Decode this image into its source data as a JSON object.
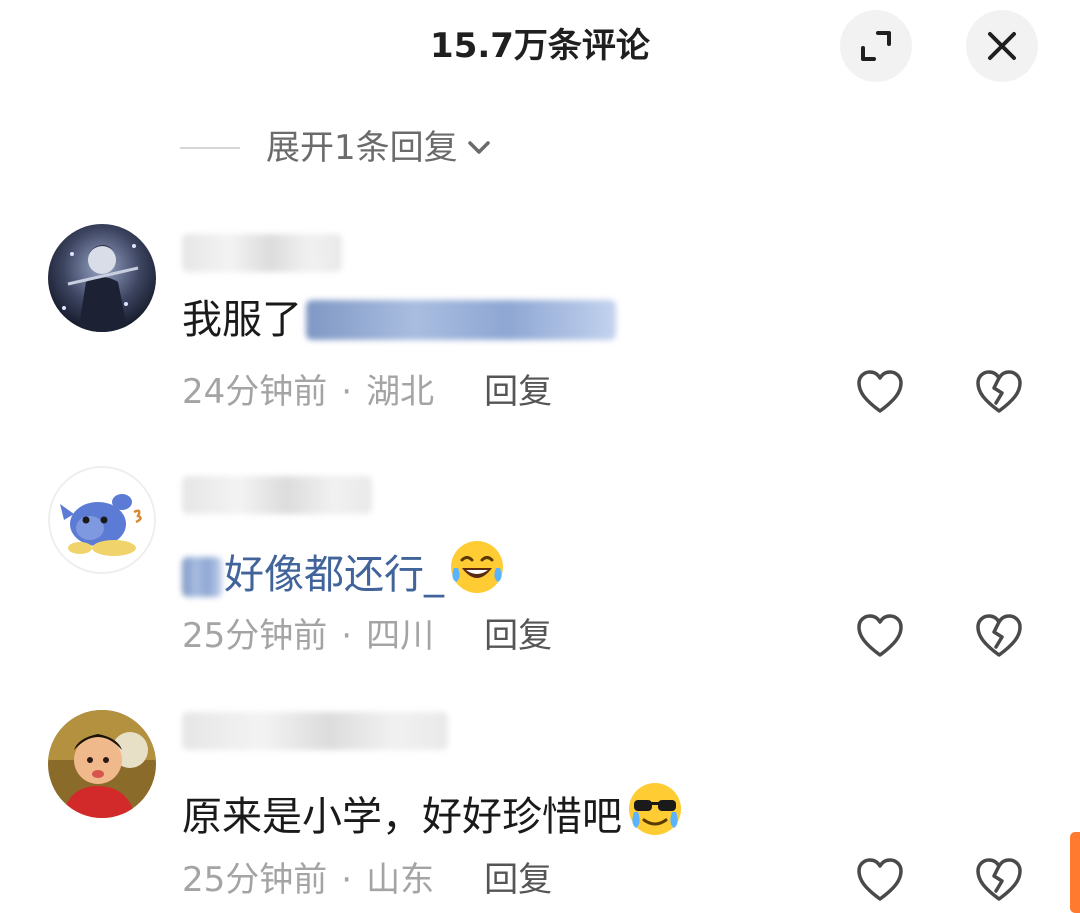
{
  "header": {
    "title": "15.7万条评论"
  },
  "expand_replies": {
    "label": "展开1条回复"
  },
  "comments": [
    {
      "content_prefix": "我服了",
      "mention": "",
      "content_suffix": "",
      "time": "24分钟前",
      "location": "湖北",
      "reply_label": "回复"
    },
    {
      "content_prefix": "",
      "mention": "好像都还行_",
      "content_suffix": "",
      "time": "25分钟前",
      "location": "四川",
      "reply_label": "回复"
    },
    {
      "content_prefix": "原来是小学，好好珍惜吧",
      "mention": "",
      "content_suffix": "",
      "time": "25分钟前",
      "location": "山东",
      "reply_label": "回复"
    }
  ],
  "separator": "·",
  "colors": {
    "accent_scrollbar": "#ff7a2e",
    "mention": "#41649a",
    "meta": "#a4a4a4"
  },
  "icons": {
    "expand": "expand-icon",
    "close": "close-icon",
    "like": "heart-icon",
    "dislike": "broken-heart-icon",
    "chevron": "chevron-down-icon"
  }
}
